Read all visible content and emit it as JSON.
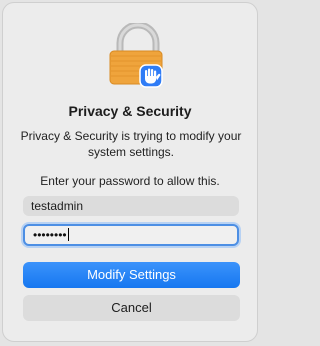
{
  "dialog": {
    "title": "Privacy & Security",
    "message": "Privacy & Security is trying to modify your system settings.",
    "prompt": "Enter your password to allow this.",
    "icon": "lock-with-hand-icon"
  },
  "form": {
    "username_value": "testadmin",
    "password_masked": "••••••••"
  },
  "buttons": {
    "primary_label": "Modify Settings",
    "secondary_label": "Cancel"
  },
  "colors": {
    "accent": "#1a7cf5",
    "lock_body": "#f2a43a",
    "hand_badge": "#2f7cf6"
  }
}
